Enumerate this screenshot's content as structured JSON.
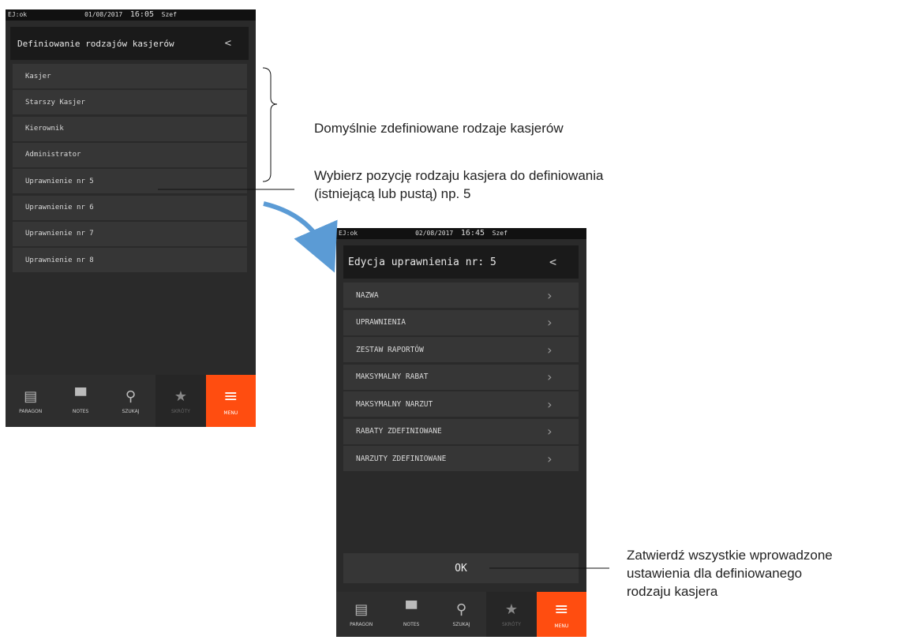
{
  "screen1": {
    "status": {
      "ej": "EJ:ok",
      "date": "01/08/2017",
      "time": "16:05",
      "user": "Szef"
    },
    "title": "Definiowanie rodzajów kasjerów",
    "back": "<",
    "items": [
      "Kasjer",
      "Starszy Kasjer",
      "Kierownik",
      "Administrator",
      "Uprawnienie nr 5",
      "Uprawnienie nr 6",
      "Uprawnienie nr 7",
      "Uprawnienie nr 8"
    ]
  },
  "screen2": {
    "status": {
      "ej": "EJ:ok",
      "date": "02/08/2017",
      "time": "16:45",
      "user": "Szef"
    },
    "title": "Edycja uprawnienia nr: 5",
    "back": "<",
    "items": [
      "NAZWA",
      "UPRAWNIENIA",
      "ZESTAW RAPORTÓW",
      "MAKSYMALNY RABAT",
      "MAKSYMALNY NARZUT",
      "RABATY ZDEFINIOWANE",
      "NARZUTY ZDEFINIOWANE"
    ],
    "ok_label": "OK"
  },
  "bottom_nav": [
    "PARAGON",
    "NOTES",
    "SZUKAJ",
    "SKRÓTY",
    "MENU"
  ],
  "annotations": {
    "default_types": "Domyślnie zdefiniowane rodzaje kasjerów",
    "select_line1": "Wybierz pozycję rodzaju kasjera do definiowania",
    "select_line2": "(istniejącą  lub pustą) np. 5",
    "confirm_line1": "Zatwierdź wszystkie wprowadzone",
    "confirm_line2": "ustawienia dla definiowanego",
    "confirm_line3": "rodzaju kasjera"
  },
  "colors": {
    "accent": "#ff4d10",
    "screen_bg": "#2a2a2a",
    "item_bg": "#363636",
    "arrow": "#5b9bd5"
  }
}
